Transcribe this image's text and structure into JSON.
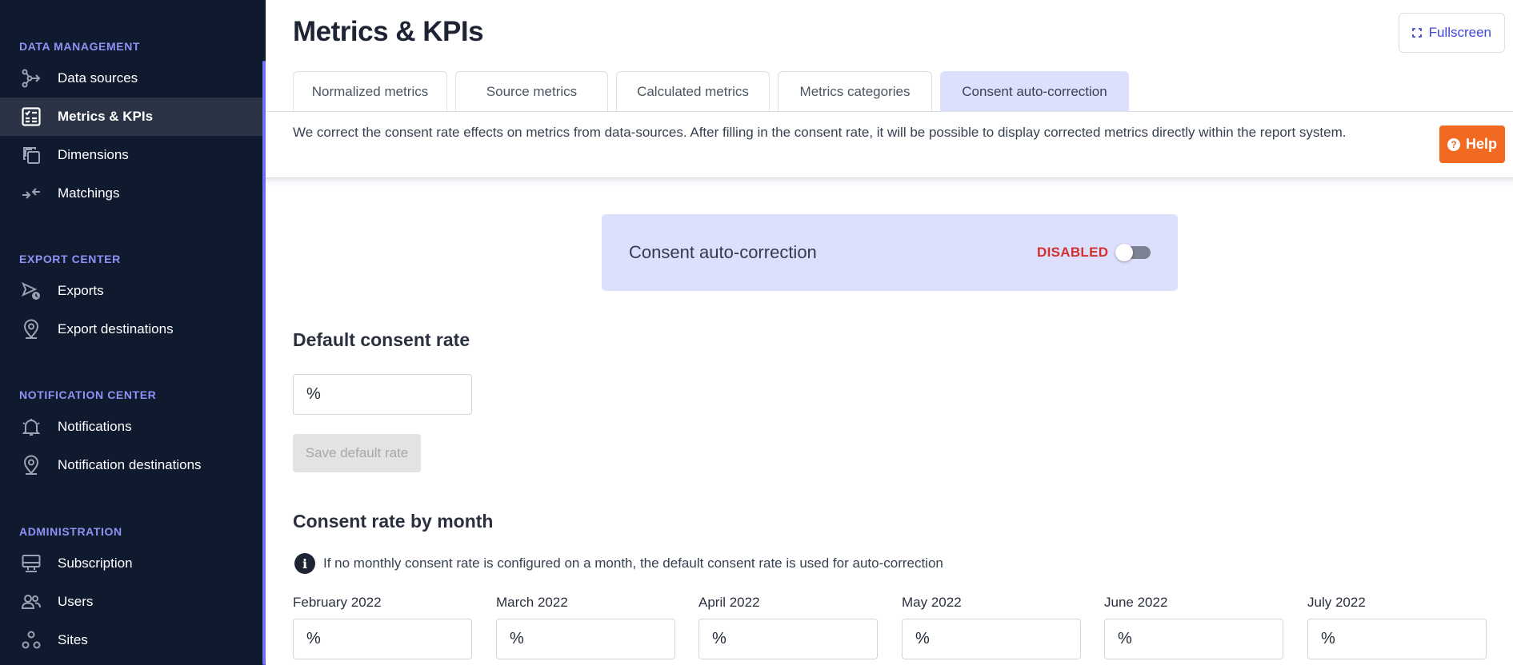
{
  "sidebar": {
    "sections": [
      {
        "heading": "DATA MANAGEMENT",
        "items": [
          {
            "label": "Data sources",
            "icon": "data-sources-icon"
          },
          {
            "label": "Metrics & KPIs",
            "icon": "metrics-icon",
            "active": true
          },
          {
            "label": "Dimensions",
            "icon": "dimensions-icon"
          },
          {
            "label": "Matchings",
            "icon": "matchings-icon"
          }
        ]
      },
      {
        "heading": "EXPORT CENTER",
        "items": [
          {
            "label": "Exports",
            "icon": "exports-icon"
          },
          {
            "label": "Export destinations",
            "icon": "location-pin-icon"
          }
        ]
      },
      {
        "heading": "NOTIFICATION CENTER",
        "items": [
          {
            "label": "Notifications",
            "icon": "bell-icon"
          },
          {
            "label": "Notification destinations",
            "icon": "location-pin-icon"
          }
        ]
      },
      {
        "heading": "ADMINISTRATION",
        "items": [
          {
            "label": "Subscription",
            "icon": "subscription-icon"
          },
          {
            "label": "Users",
            "icon": "users-icon"
          },
          {
            "label": "Sites",
            "icon": "sites-icon"
          }
        ]
      }
    ]
  },
  "header": {
    "title": "Metrics & KPIs",
    "fullscreen_label": "Fullscreen"
  },
  "tabs": [
    {
      "label": "Normalized metrics"
    },
    {
      "label": "Source metrics"
    },
    {
      "label": "Calculated metrics"
    },
    {
      "label": "Metrics categories"
    },
    {
      "label": "Consent auto-correction",
      "active": true
    }
  ],
  "description": "We correct the consent rate effects on metrics from data-sources. After filling in the consent rate, it will be possible to display corrected metrics directly within the report system.",
  "help_label": "Help",
  "consent_card": {
    "label": "Consent auto-correction",
    "status": "DISABLED",
    "enabled": false
  },
  "default_rate": {
    "heading": "Default consent rate",
    "unit": "%",
    "value": "",
    "save_label": "Save default rate"
  },
  "monthly": {
    "heading": "Consent rate by month",
    "info": "If no monthly consent rate is configured on a month, the default consent rate is used for auto-correction",
    "months": [
      {
        "label": "February 2022",
        "unit": "%",
        "value": ""
      },
      {
        "label": "March 2022",
        "unit": "%",
        "value": ""
      },
      {
        "label": "April 2022",
        "unit": "%",
        "value": ""
      },
      {
        "label": "May 2022",
        "unit": "%",
        "value": ""
      },
      {
        "label": "June 2022",
        "unit": "%",
        "value": ""
      },
      {
        "label": "July 2022",
        "unit": "%",
        "value": ""
      }
    ]
  },
  "colors": {
    "sidebar_bg": "#101a2e",
    "sidebar_heading": "#8b93f5",
    "active_tab_bg": "#dde0fd",
    "help_orange": "#f26a21",
    "disabled_red": "#d32f2f"
  }
}
